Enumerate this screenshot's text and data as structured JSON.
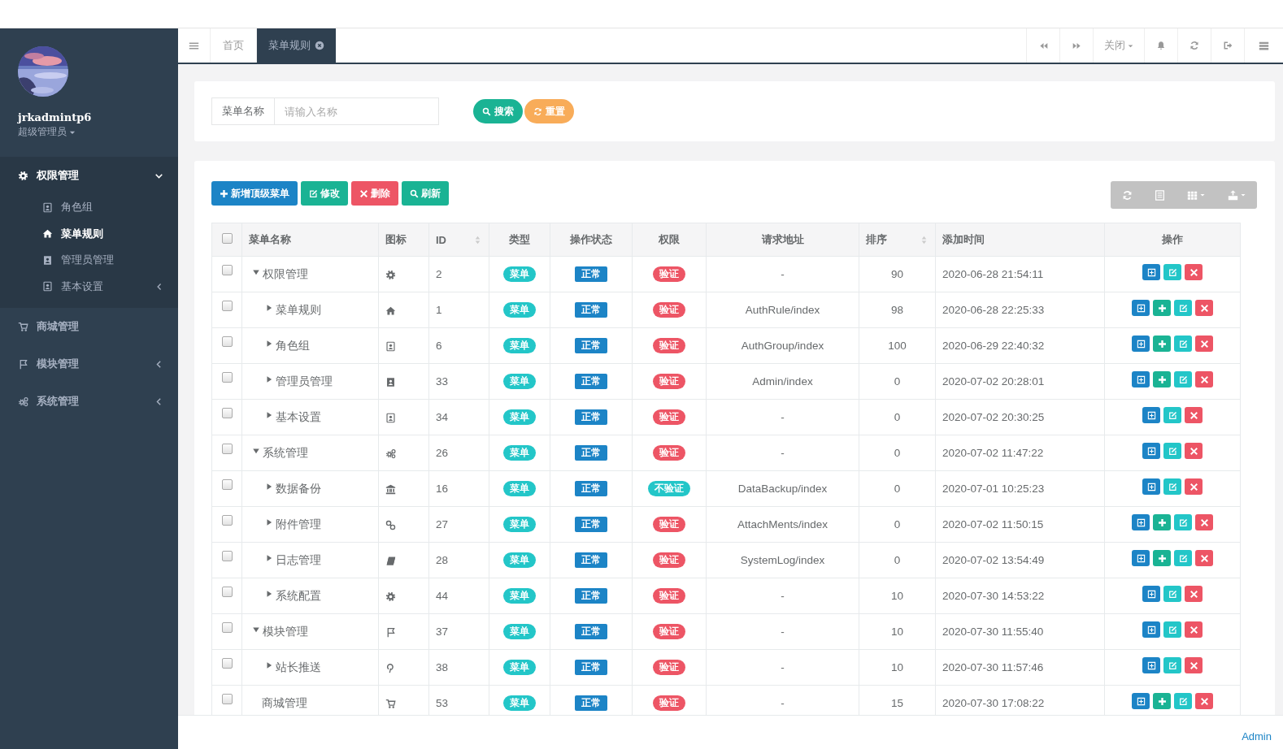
{
  "sidebar": {
    "user": {
      "name": "jrkadmintp6",
      "role": "超级管理员"
    },
    "menu": [
      {
        "label": "权限管理",
        "kind": "gear",
        "has_submenu": true,
        "expanded": true,
        "children": [
          {
            "label": "角色组",
            "kind": "contact",
            "selected": false,
            "has_submenu": false
          },
          {
            "label": "菜单规则",
            "kind": "home",
            "selected": true,
            "has_submenu": false
          },
          {
            "label": "管理员管理",
            "kind": "contactsolid",
            "selected": false,
            "has_submenu": false
          },
          {
            "label": "基本设置",
            "kind": "contact",
            "selected": false,
            "has_submenu": true
          }
        ]
      },
      {
        "label": "商城管理",
        "kind": "cart",
        "has_submenu": false,
        "expanded": false
      },
      {
        "label": "模块管理",
        "kind": "flag",
        "has_submenu": true,
        "expanded": false
      },
      {
        "label": "系统管理",
        "kind": "gears",
        "has_submenu": true,
        "expanded": false
      }
    ]
  },
  "topbar": {
    "tabs": [
      {
        "label": "首页",
        "selected": false,
        "closable": false
      },
      {
        "label": "菜单规则",
        "selected": true,
        "closable": true
      }
    ],
    "close_menu": "关闭"
  },
  "search": {
    "label": "菜单名称",
    "placeholder": "请输入名称",
    "buttons": [
      {
        "label": "搜索",
        "kind": "search"
      },
      {
        "label": "重置",
        "kind": "reset"
      }
    ]
  },
  "toolbar": {
    "buttons": [
      {
        "label": "新增顶级菜单",
        "kind": "add"
      },
      {
        "label": "修改",
        "kind": "edit"
      },
      {
        "label": "删除",
        "kind": "delete"
      },
      {
        "label": "刷新",
        "kind": "refresh"
      }
    ]
  },
  "table": {
    "header_checked": false,
    "columns": [
      {
        "label": "菜单名称",
        "sortable": false
      },
      {
        "label": "图标",
        "sortable": false
      },
      {
        "label": "ID",
        "sortable": true
      },
      {
        "label": "类型",
        "sortable": false
      },
      {
        "label": "操作状态",
        "sortable": false
      },
      {
        "label": "权限",
        "sortable": false
      },
      {
        "label": "请求地址",
        "sortable": false
      },
      {
        "label": "排序",
        "sortable": true
      },
      {
        "label": "添加时间",
        "sortable": false
      },
      {
        "label": "操作",
        "sortable": false
      }
    ],
    "rows": [
      {
        "name": "权限管理",
        "kind": "gear",
        "id": "2",
        "type": "菜单",
        "status": "正常",
        "auth": {
          "label": "验证",
          "required": true
        },
        "url": "-",
        "sort": "90",
        "time": "2020-06-28 21:54:11",
        "actions": [
          {
            "kind": "view"
          },
          {
            "kind": "edit"
          },
          {
            "kind": "delete"
          }
        ],
        "checked": false,
        "expanded": true,
        "children": [
          {
            "name": "菜单规则",
            "kind": "home",
            "id": "1",
            "type": "菜单",
            "status": "正常",
            "auth": {
              "label": "验证",
              "required": true
            },
            "url": "AuthRule/index",
            "sort": "98",
            "time": "2020-06-28 22:25:33",
            "actions": [
              {
                "kind": "view"
              },
              {
                "kind": "add"
              },
              {
                "kind": "edit"
              },
              {
                "kind": "delete"
              }
            ],
            "checked": false,
            "expanded": false
          },
          {
            "name": "角色组",
            "kind": "contact",
            "id": "6",
            "type": "菜单",
            "status": "正常",
            "auth": {
              "label": "验证",
              "required": true
            },
            "url": "AuthGroup/index",
            "sort": "100",
            "time": "2020-06-29 22:40:32",
            "actions": [
              {
                "kind": "view"
              },
              {
                "kind": "add"
              },
              {
                "kind": "edit"
              },
              {
                "kind": "delete"
              }
            ],
            "checked": false,
            "expanded": false
          },
          {
            "name": "管理员管理",
            "kind": "contactsolid",
            "id": "33",
            "type": "菜单",
            "status": "正常",
            "auth": {
              "label": "验证",
              "required": true
            },
            "url": "Admin/index",
            "sort": "0",
            "time": "2020-07-02 20:28:01",
            "actions": [
              {
                "kind": "view"
              },
              {
                "kind": "add"
              },
              {
                "kind": "edit"
              },
              {
                "kind": "delete"
              }
            ],
            "checked": false,
            "expanded": false
          },
          {
            "name": "基本设置",
            "kind": "contact",
            "id": "34",
            "type": "菜单",
            "status": "正常",
            "auth": {
              "label": "验证",
              "required": true
            },
            "url": "-",
            "sort": "0",
            "time": "2020-07-02 20:30:25",
            "actions": [
              {
                "kind": "view"
              },
              {
                "kind": "edit"
              },
              {
                "kind": "delete"
              }
            ],
            "checked": false,
            "expanded": false
          }
        ]
      },
      {
        "name": "系统管理",
        "kind": "gears",
        "id": "26",
        "type": "菜单",
        "status": "正常",
        "auth": {
          "label": "验证",
          "required": true
        },
        "url": "-",
        "sort": "0",
        "time": "2020-07-02 11:47:22",
        "actions": [
          {
            "kind": "view"
          },
          {
            "kind": "edit"
          },
          {
            "kind": "delete"
          }
        ],
        "checked": false,
        "expanded": true,
        "children": [
          {
            "name": "数据备份",
            "kind": "bank",
            "id": "16",
            "type": "菜单",
            "status": "正常",
            "auth": {
              "label": "不验证",
              "required": false
            },
            "url": "DataBackup/index",
            "sort": "0",
            "time": "2020-07-01 10:25:23",
            "actions": [
              {
                "kind": "view"
              },
              {
                "kind": "edit"
              },
              {
                "kind": "delete"
              }
            ],
            "checked": false,
            "expanded": false
          },
          {
            "name": "附件管理",
            "kind": "link",
            "id": "27",
            "type": "菜单",
            "status": "正常",
            "auth": {
              "label": "验证",
              "required": true
            },
            "url": "AttachMents/index",
            "sort": "0",
            "time": "2020-07-02 11:50:15",
            "actions": [
              {
                "kind": "view"
              },
              {
                "kind": "add"
              },
              {
                "kind": "edit"
              },
              {
                "kind": "delete"
              }
            ],
            "checked": false,
            "expanded": false
          },
          {
            "name": "日志管理",
            "kind": "book",
            "id": "28",
            "type": "菜单",
            "status": "正常",
            "auth": {
              "label": "验证",
              "required": true
            },
            "url": "SystemLog/index",
            "sort": "0",
            "time": "2020-07-02 13:54:49",
            "actions": [
              {
                "kind": "view"
              },
              {
                "kind": "add"
              },
              {
                "kind": "edit"
              },
              {
                "kind": "delete"
              }
            ],
            "checked": false,
            "expanded": false
          },
          {
            "name": "系统配置",
            "kind": "gear",
            "id": "44",
            "type": "菜单",
            "status": "正常",
            "auth": {
              "label": "验证",
              "required": true
            },
            "url": "-",
            "sort": "10",
            "time": "2020-07-30 14:53:22",
            "actions": [
              {
                "kind": "view"
              },
              {
                "kind": "edit"
              },
              {
                "kind": "delete"
              }
            ],
            "checked": false,
            "expanded": false
          }
        ]
      },
      {
        "name": "模块管理",
        "kind": "flag",
        "id": "37",
        "type": "菜单",
        "status": "正常",
        "auth": {
          "label": "验证",
          "required": true
        },
        "url": "-",
        "sort": "10",
        "time": "2020-07-30 11:55:40",
        "actions": [
          {
            "kind": "view"
          },
          {
            "kind": "edit"
          },
          {
            "kind": "delete"
          }
        ],
        "checked": false,
        "expanded": true,
        "children": [
          {
            "name": "站长推送",
            "kind": "pin",
            "id": "38",
            "type": "菜单",
            "status": "正常",
            "auth": {
              "label": "验证",
              "required": true
            },
            "url": "-",
            "sort": "10",
            "time": "2020-07-30 11:57:46",
            "actions": [
              {
                "kind": "view"
              },
              {
                "kind": "edit"
              },
              {
                "kind": "delete"
              }
            ],
            "checked": false,
            "expanded": false
          }
        ]
      },
      {
        "name": "商城管理",
        "kind": "cart",
        "id": "53",
        "type": "菜单",
        "status": "正常",
        "auth": {
          "label": "验证",
          "required": true
        },
        "url": "-",
        "sort": "15",
        "time": "2020-07-30 17:08:22",
        "actions": [
          {
            "kind": "view"
          },
          {
            "kind": "add"
          },
          {
            "kind": "edit"
          },
          {
            "kind": "delete"
          }
        ],
        "checked": false
      }
    ]
  },
  "footer": {
    "text": "Admin"
  }
}
